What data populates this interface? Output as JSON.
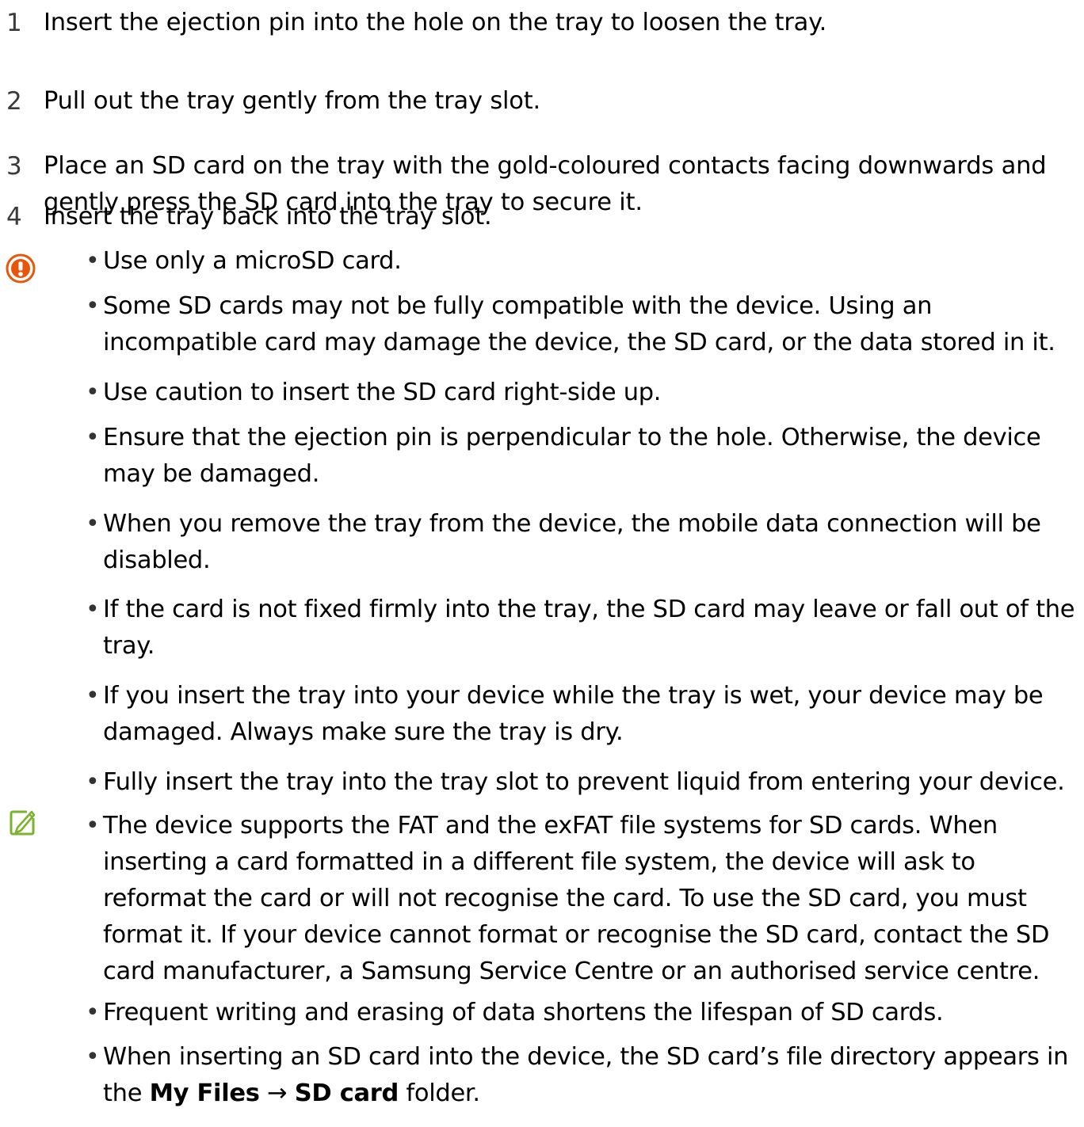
{
  "steps": [
    {
      "num": "1",
      "text": "Insert the ejection pin into the hole on the tray to loosen the tray."
    },
    {
      "num": "2",
      "text": "Pull out the tray gently from the tray slot."
    },
    {
      "num": "3",
      "text": "Place an SD card on the tray with the gold-coloured contacts facing downwards and gently press the SD card into the tray to secure it."
    },
    {
      "num": "4",
      "text": "Insert the tray back into the tray slot."
    }
  ],
  "caution": {
    "icon": "caution-icon",
    "color": "#e8560c",
    "bullets": [
      "Use only a microSD card.",
      "Some SD cards may not be fully compatible with the device. Using an incompatible card may damage the device, the SD card, or the data stored in it.",
      "Use caution to insert the SD card right-side up.",
      "Ensure that the ejection pin is perpendicular to the hole. Otherwise, the device may be damaged.",
      "When you remove the tray from the device, the mobile data connection will be disabled.",
      "If the card is not fixed firmly into the tray, the SD card may leave or fall out of the tray.",
      "If you insert the tray into your device while the tray is wet, your device may be damaged. Always make sure the tray is dry.",
      "Fully insert the tray into the tray slot to prevent liquid from entering your device."
    ]
  },
  "note": {
    "icon": "note-icon",
    "color": "#7ab32e",
    "bullets": [
      "The device supports the FAT and the exFAT file systems for SD cards. When inserting a card formatted in a different file system, the device will ask to reformat the card or will not recognise the card. To use the SD card, you must format it. If your device cannot format or recognise the SD card, contact the SD card manufacturer, a Samsung Service Centre or an authorised service centre.",
      "Frequent writing and erasing of data shortens the lifespan of SD cards."
    ],
    "last_bullet": {
      "prefix": "When inserting an SD card into the device, the SD card’s file directory appears in the ",
      "menu_1": "My Files",
      "arrow": "→",
      "menu_2": "SD card",
      "suffix": " folder."
    }
  }
}
